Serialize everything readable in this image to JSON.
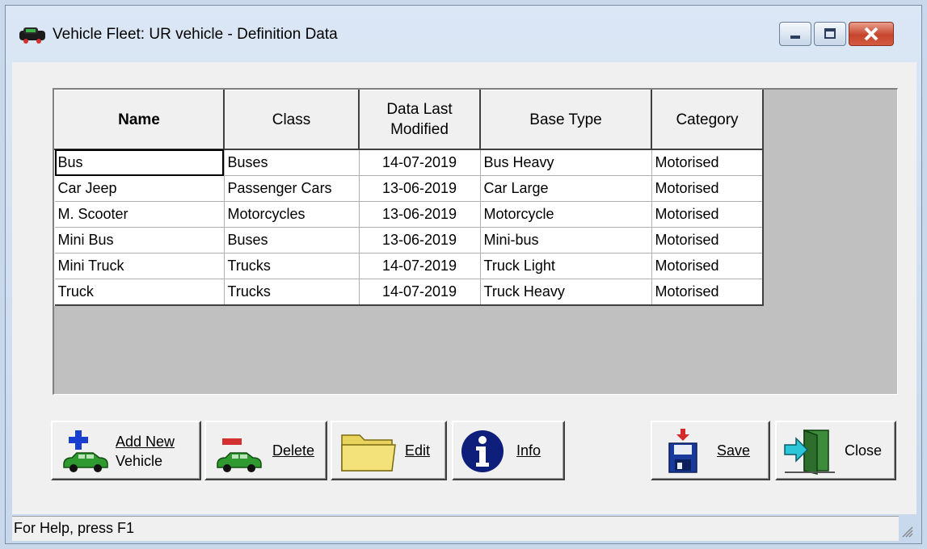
{
  "window": {
    "title": "Vehicle Fleet: UR vehicle - Definition Data",
    "controls": [
      "minimize",
      "maximize",
      "close"
    ]
  },
  "grid": {
    "columns": [
      {
        "key": "name",
        "label": "Name"
      },
      {
        "key": "class",
        "label": "Class"
      },
      {
        "key": "modified",
        "label": "Data Last\nModified"
      },
      {
        "key": "base_type",
        "label": "Base Type"
      },
      {
        "key": "category",
        "label": "Category"
      }
    ],
    "rows": [
      {
        "name": "Bus",
        "class": "Buses",
        "modified": "14-07-2019",
        "base_type": "Bus Heavy",
        "category": "Motorised"
      },
      {
        "name": "Car Jeep",
        "class": "Passenger Cars",
        "modified": "13-06-2019",
        "base_type": "Car Large",
        "category": "Motorised"
      },
      {
        "name": "M. Scooter",
        "class": "Motorcycles",
        "modified": "13-06-2019",
        "base_type": "Motorcycle",
        "category": "Motorised"
      },
      {
        "name": "Mini Bus",
        "class": "Buses",
        "modified": "13-06-2019",
        "base_type": "Mini-bus",
        "category": "Motorised"
      },
      {
        "name": "Mini Truck",
        "class": "Trucks",
        "modified": "14-07-2019",
        "base_type": "Truck Light",
        "category": "Motorised"
      },
      {
        "name": "Truck",
        "class": "Trucks",
        "modified": "14-07-2019",
        "base_type": "Truck Heavy",
        "category": "Motorised"
      }
    ]
  },
  "buttons": {
    "add_new_line1": "Add New",
    "add_new_line2": "Vehicle",
    "delete": "Delete",
    "edit": "Edit",
    "info": "Info",
    "save": "Save",
    "close": "Close"
  },
  "status": {
    "help_text": "For Help, press F1"
  },
  "icons": {
    "add": "car-plus-icon",
    "delete": "car-minus-icon",
    "edit": "folder-icon",
    "info": "info-icon",
    "save": "save-disk-icon",
    "close": "exit-door-icon"
  },
  "colors": {
    "car": "#2f9a2f",
    "plus": "#1a3fd0",
    "minus": "#d43030",
    "folder": "#f3e27a",
    "info": "#0d1f7a"
  }
}
